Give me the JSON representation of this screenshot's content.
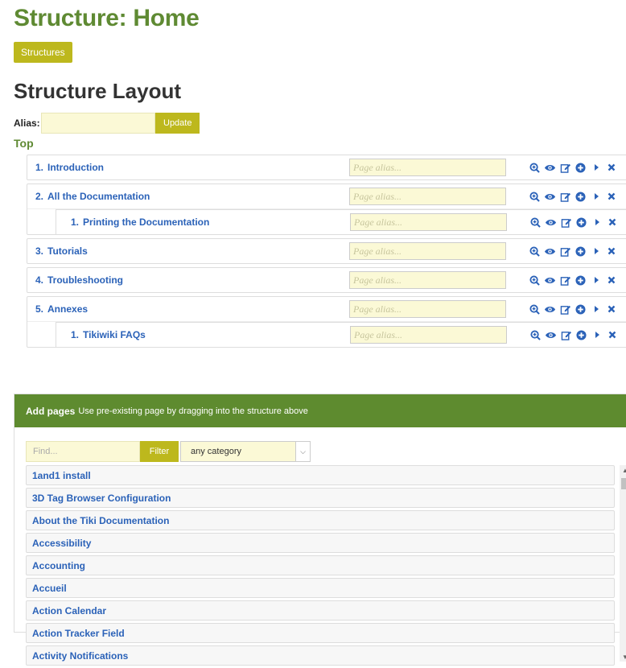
{
  "page": {
    "title": "Structure: Home",
    "structures_button": "Structures",
    "layout_title": "Structure Layout"
  },
  "alias": {
    "label": "Alias:",
    "value": "",
    "update_button": "Update"
  },
  "top_link": "Top",
  "tree": [
    {
      "num": "1.",
      "title": "Introduction",
      "placeholder": "Page alias...",
      "children": []
    },
    {
      "num": "2.",
      "title": "All the Documentation",
      "placeholder": "Page alias...",
      "children": [
        {
          "num": "1.",
          "title": "Printing the Documentation",
          "placeholder": "Page alias..."
        }
      ]
    },
    {
      "num": "3.",
      "title": "Tutorials",
      "placeholder": "Page alias...",
      "children": []
    },
    {
      "num": "4.",
      "title": "Troubleshooting",
      "placeholder": "Page alias...",
      "children": []
    },
    {
      "num": "5.",
      "title": "Annexes",
      "placeholder": "Page alias...",
      "children": [
        {
          "num": "1.",
          "title": "Tikiwiki FAQs",
          "placeholder": "Page alias..."
        }
      ]
    }
  ],
  "row_icons": [
    "zoom-in-icon",
    "eye-icon",
    "edit-icon",
    "plus-circle-icon",
    "caret-right-icon",
    "close-icon"
  ],
  "add_pages": {
    "title": "Add pages",
    "description": "Use pre-existing page by dragging into the structure above",
    "find_placeholder": "Find...",
    "filter_button": "Filter",
    "category_selected": "any category",
    "pages": [
      "1and1 install",
      "3D Tag Browser Configuration",
      "About the Tiki Documentation",
      "Accessibility",
      "Accounting",
      "Accueil",
      "Action Calendar",
      "Action Tracker Field",
      "Activity Notifications"
    ]
  },
  "colors": {
    "heading_green": "#5f8a33",
    "button_olive": "#bdb81d",
    "link_blue": "#2b62b8",
    "input_yellow": "#fbf9d6"
  }
}
